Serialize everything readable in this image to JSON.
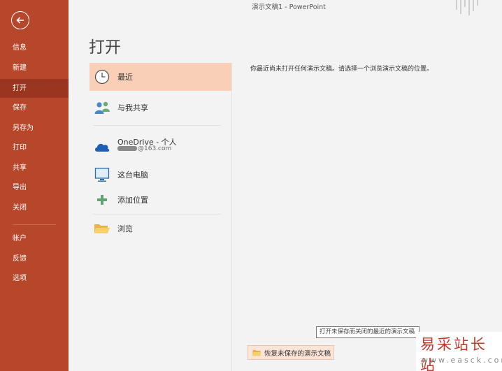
{
  "window": {
    "title": "演示文稿1  -  PowerPoint"
  },
  "sidebar": {
    "items": [
      {
        "label": "信息"
      },
      {
        "label": "新建"
      },
      {
        "label": "打开"
      },
      {
        "label": "保存"
      },
      {
        "label": "另存为"
      },
      {
        "label": "打印"
      },
      {
        "label": "共享"
      },
      {
        "label": "导出"
      },
      {
        "label": "关闭"
      },
      {
        "label": "帐户"
      },
      {
        "label": "反馈"
      },
      {
        "label": "选项"
      }
    ],
    "active_label": "打开",
    "accent_color": "#b7472a"
  },
  "page": {
    "title": "打开"
  },
  "locations": {
    "items": [
      {
        "label": "最近",
        "icon": "clock-icon"
      },
      {
        "label": "与我共享",
        "icon": "people-icon"
      },
      {
        "label": "OneDrive - 个人",
        "sub": "@163.com",
        "icon": "cloud-icon"
      },
      {
        "label": "这台电脑",
        "icon": "computer-icon"
      },
      {
        "label": "添加位置",
        "icon": "plus-icon"
      },
      {
        "label": "浏览",
        "icon": "folder-icon"
      }
    ],
    "active_label": "最近"
  },
  "main": {
    "empty_message": "你最近尚未打开任何演示文稿。请选择一个浏览演示文稿的位置。",
    "recover_button": "恢复未保存的演示文稿",
    "tooltip": "打开未保存而关闭的最近的演示文稿"
  },
  "watermark": {
    "title": "易采站长站",
    "sub": "www.easck.com"
  }
}
